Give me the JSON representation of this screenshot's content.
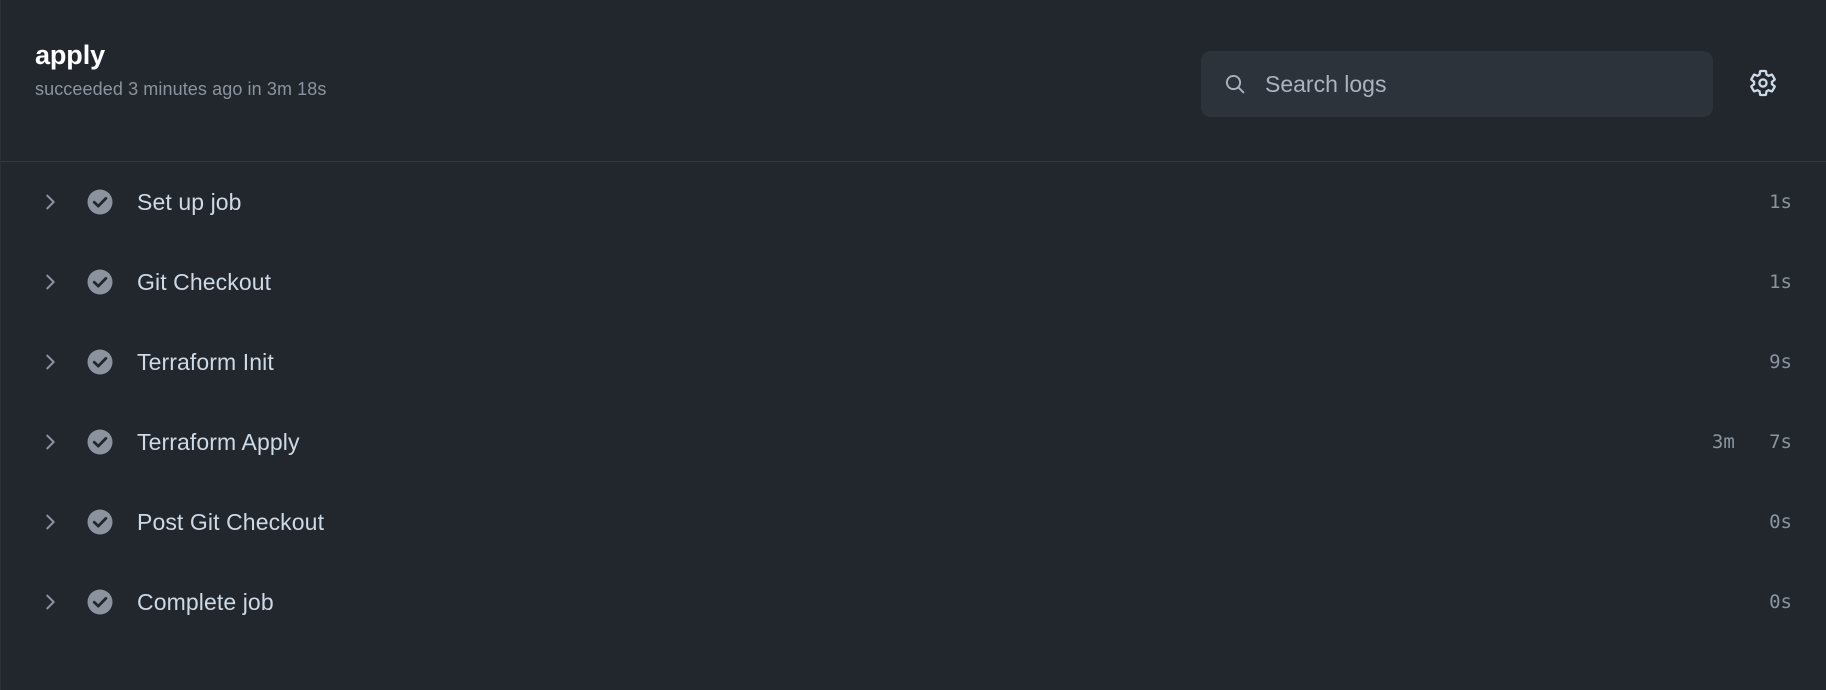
{
  "header": {
    "title": "apply",
    "subtitle": "succeeded 3 minutes ago in 3m 18s",
    "search": {
      "placeholder": "Search logs",
      "value": "",
      "icon": "search-icon"
    },
    "settings": {
      "icon": "gear-icon",
      "label": "Settings"
    }
  },
  "colors": {
    "background": "#22272e",
    "header_border": "#323941",
    "search_background": "#2d333b",
    "title_text": "#ffffff",
    "muted_text": "#8b949e",
    "primary_text": "#cdd9e5",
    "success_icon": "#8b949e",
    "success_check": "#22272e"
  },
  "steps": [
    {
      "name": "Set up job",
      "status": "succeeded",
      "status_icon": "check-circle-icon",
      "expand_icon": "chevron-right-icon",
      "duration": "     1s",
      "expanded": false
    },
    {
      "name": "Git Checkout",
      "status": "succeeded",
      "status_icon": "check-circle-icon",
      "expand_icon": "chevron-right-icon",
      "duration": "     1s",
      "expanded": false
    },
    {
      "name": "Terraform Init",
      "status": "succeeded",
      "status_icon": "check-circle-icon",
      "expand_icon": "chevron-right-icon",
      "duration": "     9s",
      "expanded": false
    },
    {
      "name": "Terraform Apply",
      "status": "succeeded",
      "status_icon": "check-circle-icon",
      "expand_icon": "chevron-right-icon",
      "duration": "3m   7s",
      "expanded": false
    },
    {
      "name": "Post Git Checkout",
      "status": "succeeded",
      "status_icon": "check-circle-icon",
      "expand_icon": "chevron-right-icon",
      "duration": "     0s",
      "expanded": false
    },
    {
      "name": "Complete job",
      "status": "succeeded",
      "status_icon": "check-circle-icon",
      "expand_icon": "chevron-right-icon",
      "duration": "     0s",
      "expanded": false
    }
  ]
}
